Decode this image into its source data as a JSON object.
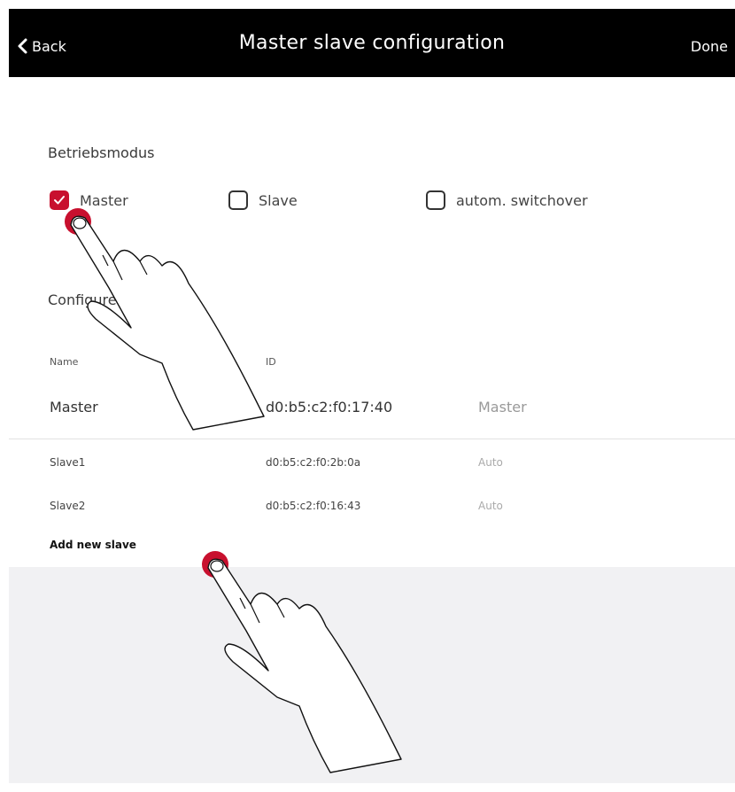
{
  "navbar": {
    "back_label": "Back",
    "title": "Master slave configuration",
    "done_label": "Done"
  },
  "mode": {
    "section_label": "Betriebsmodus",
    "options": [
      {
        "label": "Master",
        "checked": true
      },
      {
        "label": "Slave",
        "checked": false
      },
      {
        "label": "autom. switchover",
        "checked": false
      }
    ]
  },
  "config": {
    "section_label": "Configure",
    "columns": {
      "name": "Name",
      "id": "ID"
    },
    "master": {
      "name": "Master",
      "id": "d0:b5:c2:f0:17:40",
      "role": "Master"
    },
    "slaves": [
      {
        "name": "Slave1",
        "id": "d0:b5:c2:f0:2b:0a",
        "role": "Auto"
      },
      {
        "name": "Slave2",
        "id": "d0:b5:c2:f0:16:43",
        "role": "Auto"
      }
    ],
    "add_label": "Add new slave"
  },
  "colors": {
    "accent": "#c8102e",
    "navbar": "#000000",
    "footer_bg": "#f1f1f3"
  },
  "icons": [
    "chevron-left-icon",
    "checkmark-icon",
    "tap-hand-icon"
  ]
}
